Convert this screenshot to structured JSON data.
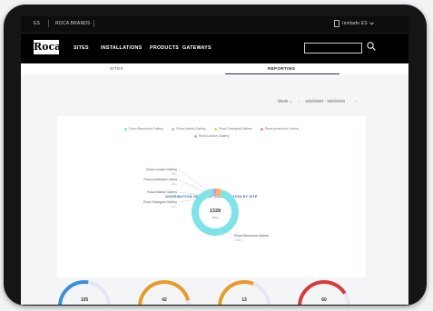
{
  "top_strip": {
    "lang": "ES",
    "brand_link": "ROCA BRANDS",
    "account": "Invitado ES"
  },
  "nav": {
    "logo": "Roca",
    "items": [
      "SITES",
      "INSTALLATIONS",
      "PRODUCTS",
      "GATEWAYS"
    ],
    "search_placeholder": ""
  },
  "tabs": [
    "SITES",
    "REPORTING"
  ],
  "controls": {
    "period": "Week",
    "date_range": "15/2/2020 - 15/2/2020"
  },
  "chart_data": {
    "type": "pie",
    "title": "DISTRIBUTION OF WATER CONSUMPTION BY SITE",
    "center_value": "1328",
    "center_unit": "litres",
    "legend": [
      {
        "name": "Roca Barcelona Gallery",
        "color": "#7fe3e8"
      },
      {
        "name": "Roca Madrid Gallery",
        "color": "#f2b07a"
      },
      {
        "name": "Roca Shanghai Gallery",
        "color": "#c8d86a"
      },
      {
        "name": "Roca productos Lisboa",
        "color": "#f08a8a"
      },
      {
        "name": "Roca London Gallery",
        "color": "#a9b8e8"
      }
    ],
    "slices": [
      {
        "label": "Roca London Gallery",
        "value": 28,
        "color": "#a9b8e8"
      },
      {
        "label": "Roca productos Lisboa",
        "value": 16,
        "color": "#f08a8a"
      },
      {
        "label": "Roca Madrid Gallery",
        "value": 44,
        "color": "#f2b07a"
      },
      {
        "label": "Roca Shanghai Gallery",
        "value": 12,
        "color": "#c8d86a"
      },
      {
        "label": "Roca Barcelona Gallery",
        "value": 1228,
        "color": "#7fe3e8"
      }
    ],
    "left_labels": [
      {
        "name": "Roca London Gallery",
        "sub": "28 L"
      },
      {
        "name": "Roca productos Lisboa",
        "sub": "16 L"
      },
      {
        "name": "Roca Madrid Gallery",
        "sub": "44 L"
      },
      {
        "name": "Roca Shanghai Gallery",
        "sub": "12 L"
      }
    ],
    "right_label": {
      "name": "Roca Barcelona Gallery",
      "sub": "1228 L"
    }
  },
  "gauges": [
    {
      "value": "105",
      "fraction": 0.55,
      "color": "#3a8fd8"
    },
    {
      "value": "42",
      "fraction": 0.92,
      "color": "#e89b2d"
    },
    {
      "value": "13",
      "fraction": 0.62,
      "color": "#e89b2d"
    },
    {
      "value": "60",
      "fraction": 0.82,
      "color": "#d63a3a"
    }
  ]
}
